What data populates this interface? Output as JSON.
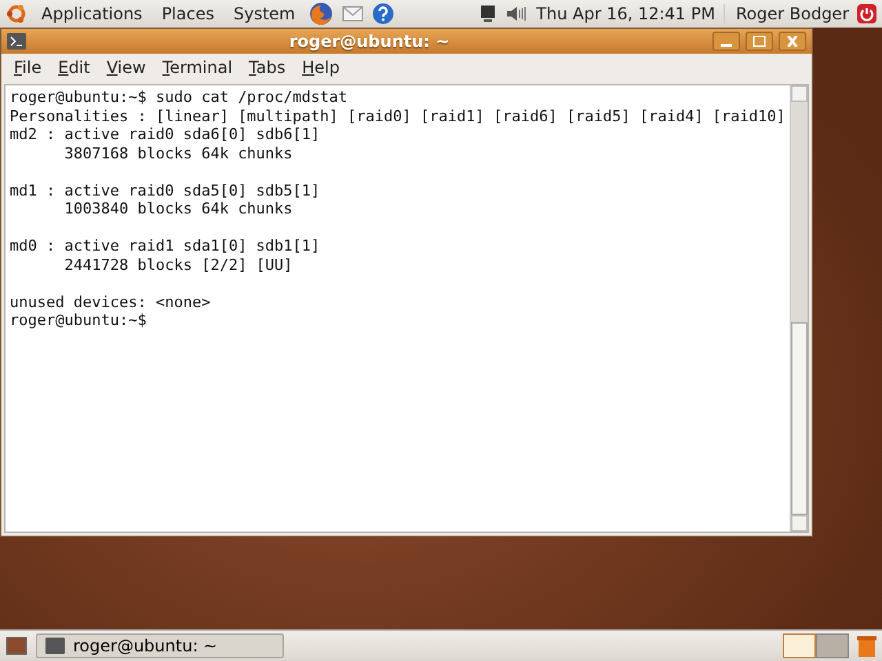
{
  "top_panel": {
    "menus": [
      "Applications",
      "Places",
      "System"
    ],
    "clock": "Thu Apr 16, 12:41 PM",
    "user": "Roger Bodger"
  },
  "window": {
    "title": "roger@ubuntu: ~",
    "menu": [
      "File",
      "Edit",
      "View",
      "Terminal",
      "Tabs",
      "Help"
    ],
    "terminal_blocks": [
      [
        "roger@ubuntu:~$ sudo cat /proc/mdstat",
        "Personalities : [linear] [multipath] [raid0] [raid1] [raid6] [raid5] [raid4] [raid10]",
        "md2 : active raid0 sda6[0] sdb6[1]",
        "      3807168 blocks 64k chunks"
      ],
      [
        "md1 : active raid0 sda5[0] sdb5[1]",
        "      1003840 blocks 64k chunks"
      ],
      [
        "md0 : active raid1 sda1[0] sdb1[1]",
        "      2441728 blocks [2/2] [UU]"
      ],
      [
        "unused devices: <none>",
        "roger@ubuntu:~$"
      ]
    ]
  },
  "bottom_panel": {
    "tasks": [
      {
        "label": "roger@ubuntu: ~",
        "selected": false
      }
    ],
    "workspaces": [
      {
        "selected": true
      },
      {
        "selected": false
      }
    ]
  }
}
